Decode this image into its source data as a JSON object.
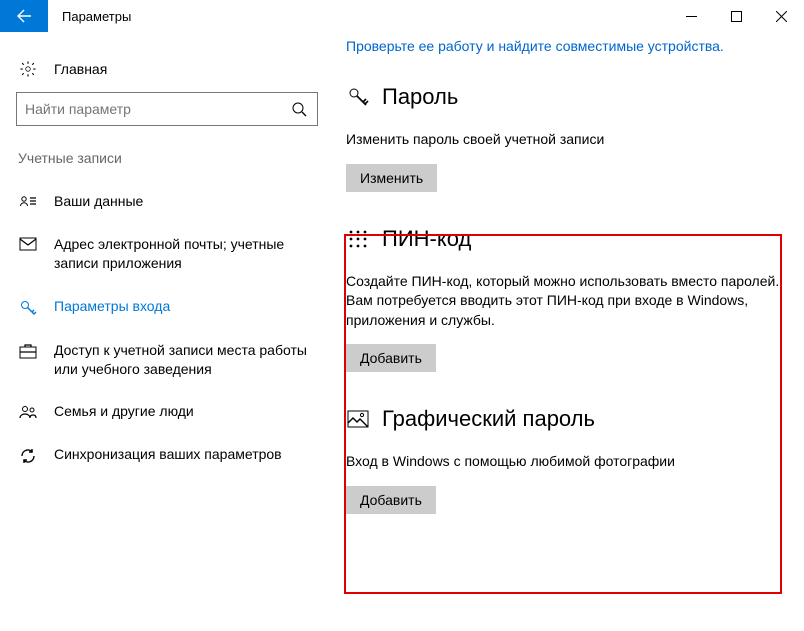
{
  "window": {
    "title": "Параметры"
  },
  "sidebar": {
    "home": "Главная",
    "search_placeholder": "Найти параметр",
    "group": "Учетные записи",
    "items": [
      {
        "label": "Ваши данные"
      },
      {
        "label": "Адрес электронной почты; учетные записи приложения"
      },
      {
        "label": "Параметры входа"
      },
      {
        "label": "Доступ к учетной записи места работы или учебного заведения"
      },
      {
        "label": "Семья и другие люди"
      },
      {
        "label": "Синхронизация ваших параметров"
      }
    ]
  },
  "main": {
    "link": "Проверьте ее работу и найдите совместимые устройства.",
    "pwd": {
      "title": "Пароль",
      "desc": "Изменить пароль своей учетной записи",
      "btn": "Изменить"
    },
    "pin": {
      "title": "ПИН-код",
      "desc": "Создайте ПИН-код, который можно использовать вместо паролей. Вам потребуется вводить этот ПИН-код при входе в Windows, приложения и службы.",
      "btn": "Добавить"
    },
    "pic": {
      "title": "Графический пароль",
      "desc": "Вход в Windows с помощью любимой фотографии",
      "btn": "Добавить"
    }
  }
}
